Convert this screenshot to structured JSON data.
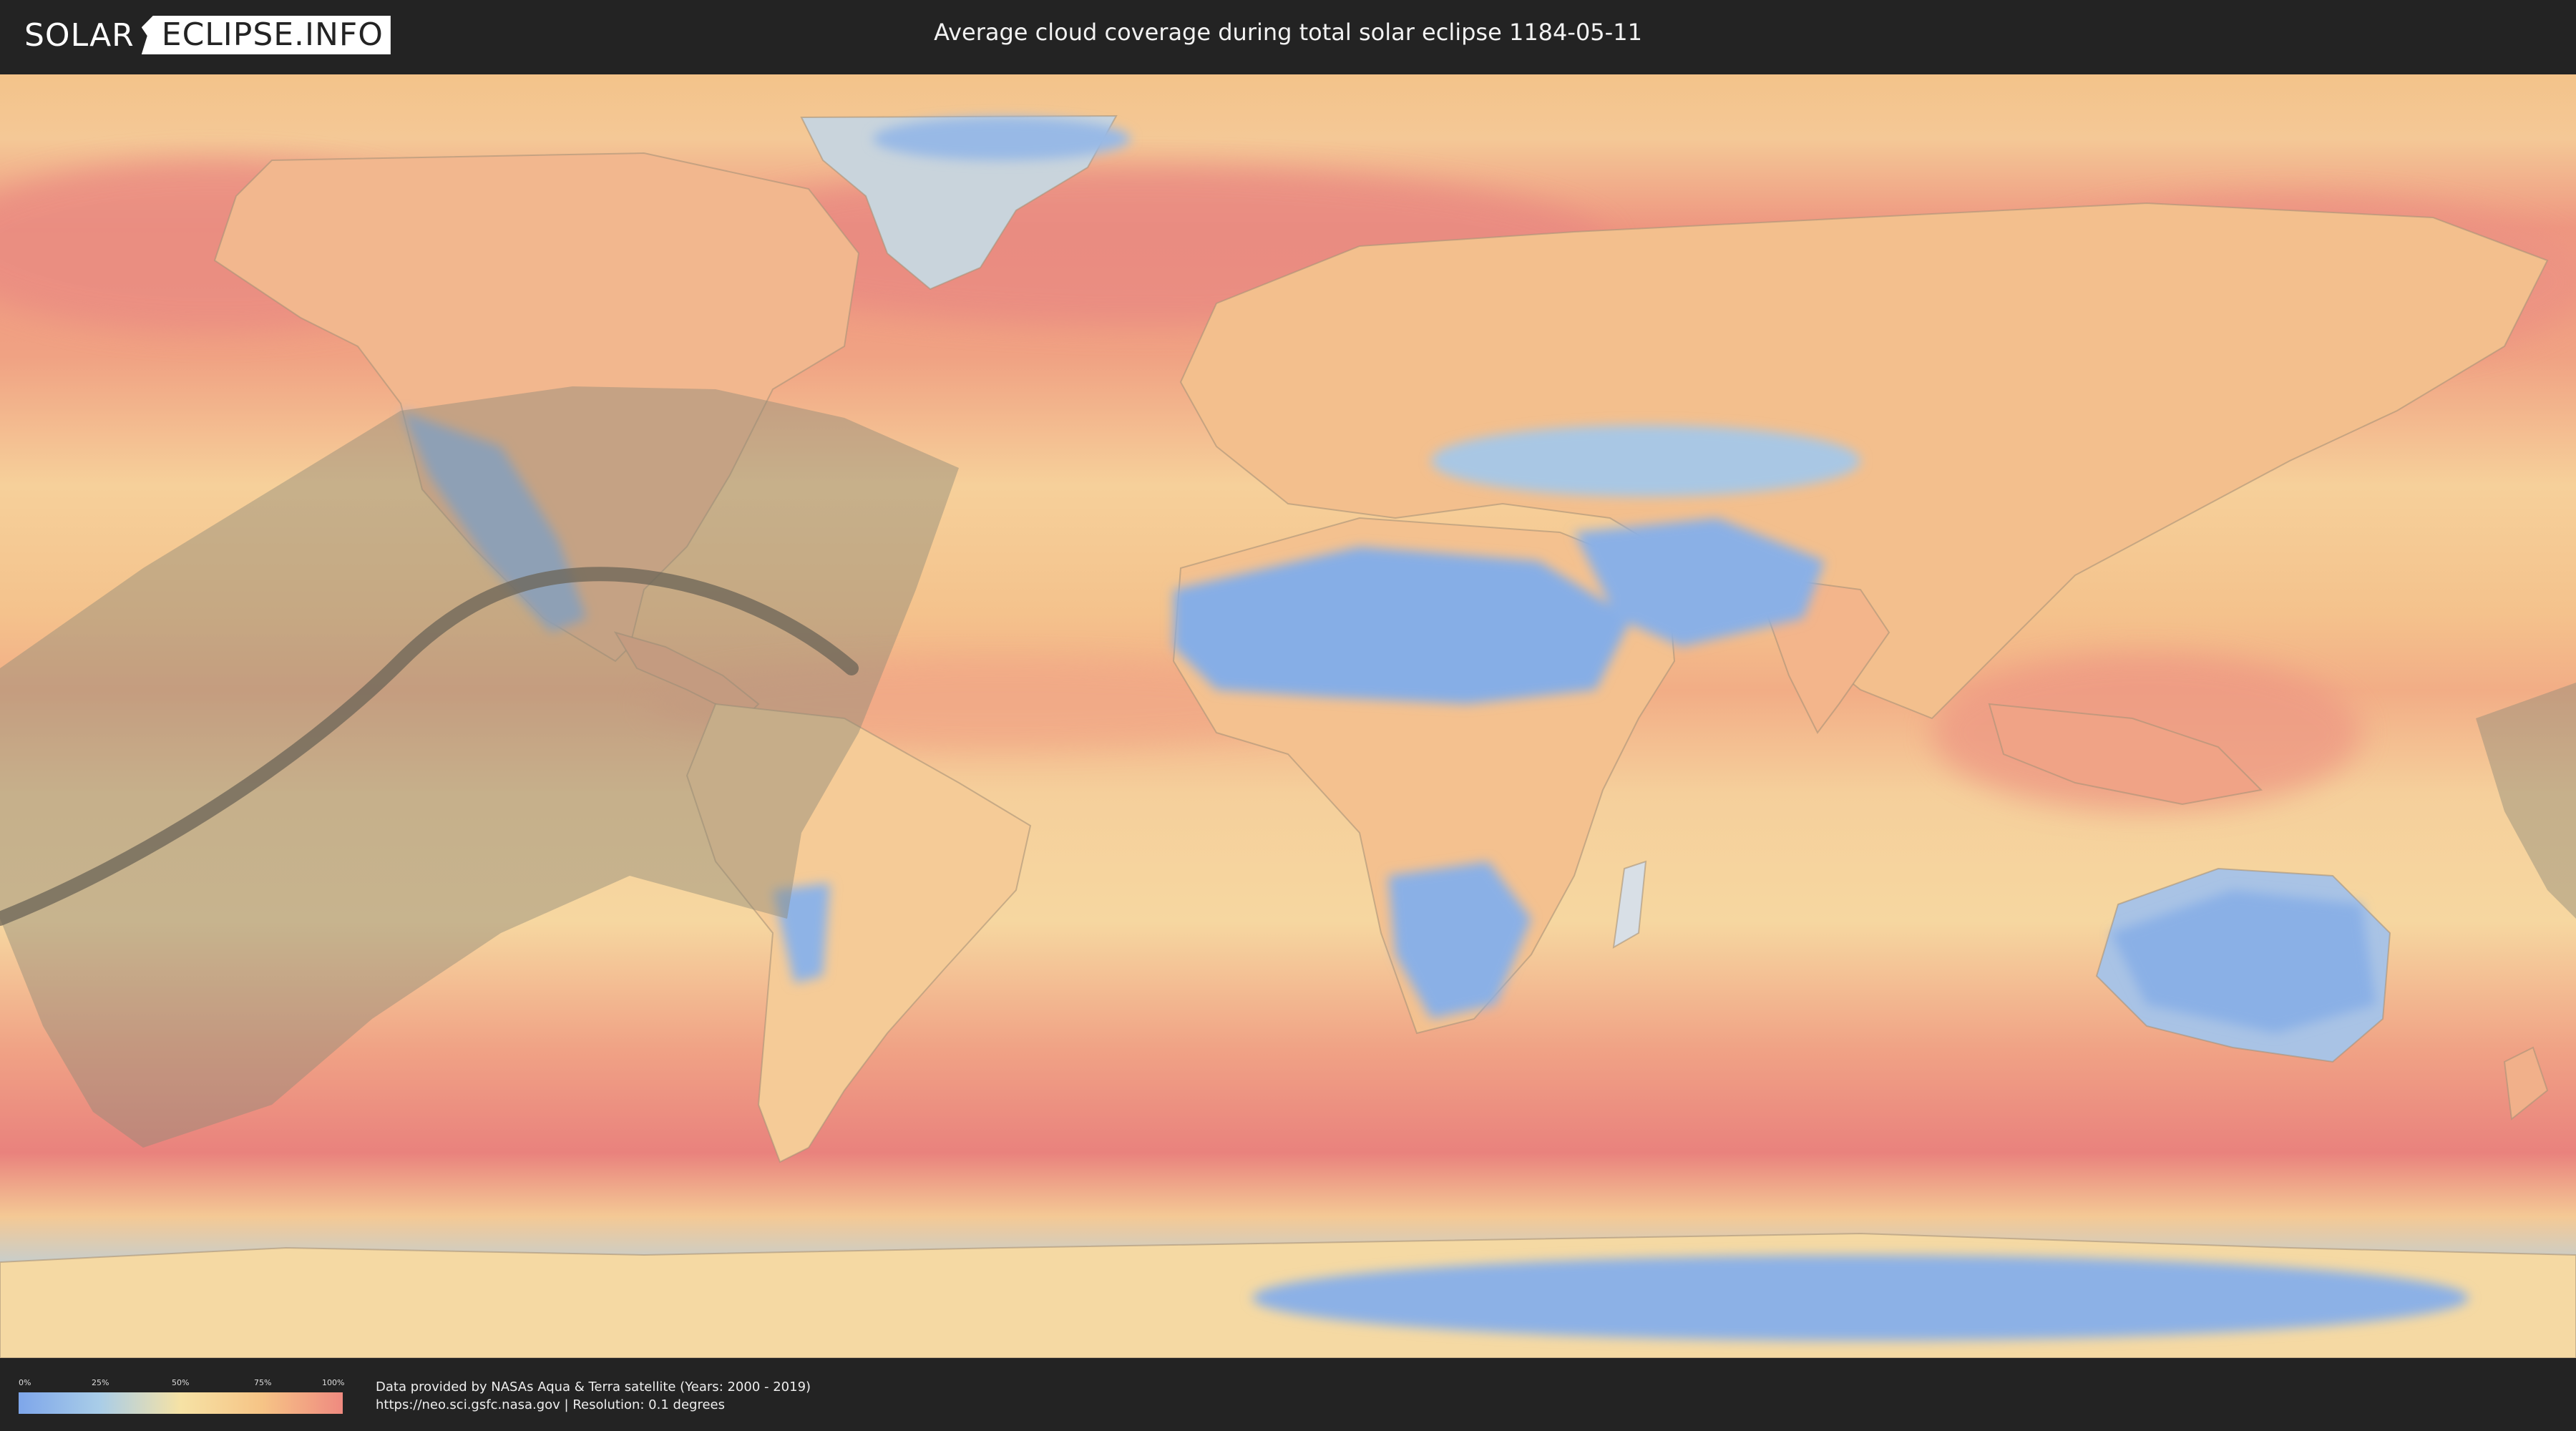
{
  "header": {
    "logo_left": "SOLAR",
    "logo_right": "ECLIPSE.INFO",
    "title": "Average cloud coverage during total solar eclipse 1184-05-11"
  },
  "legend": {
    "ticks": [
      "0%",
      "25%",
      "50%",
      "75%",
      "100%"
    ],
    "colors": [
      "#7ea6ea",
      "#a9cde8",
      "#f6e2a5",
      "#f6c486",
      "#ef8a80"
    ]
  },
  "credits": {
    "line1": "Data provided by NASAs Aqua & Terra satellite (Years: 2000 - 2019)",
    "line2": "https://neo.sci.gsfc.nasa.gov | Resolution: 0.1 degrees"
  },
  "map": {
    "ocean_tropics_color": "#f4c48a",
    "ocean_storm_color": "#ea8680",
    "clear_color": "#86aee6",
    "eclipse_path_color": "#6b6457",
    "eclipse_shadow_color": "#8e8a78"
  }
}
